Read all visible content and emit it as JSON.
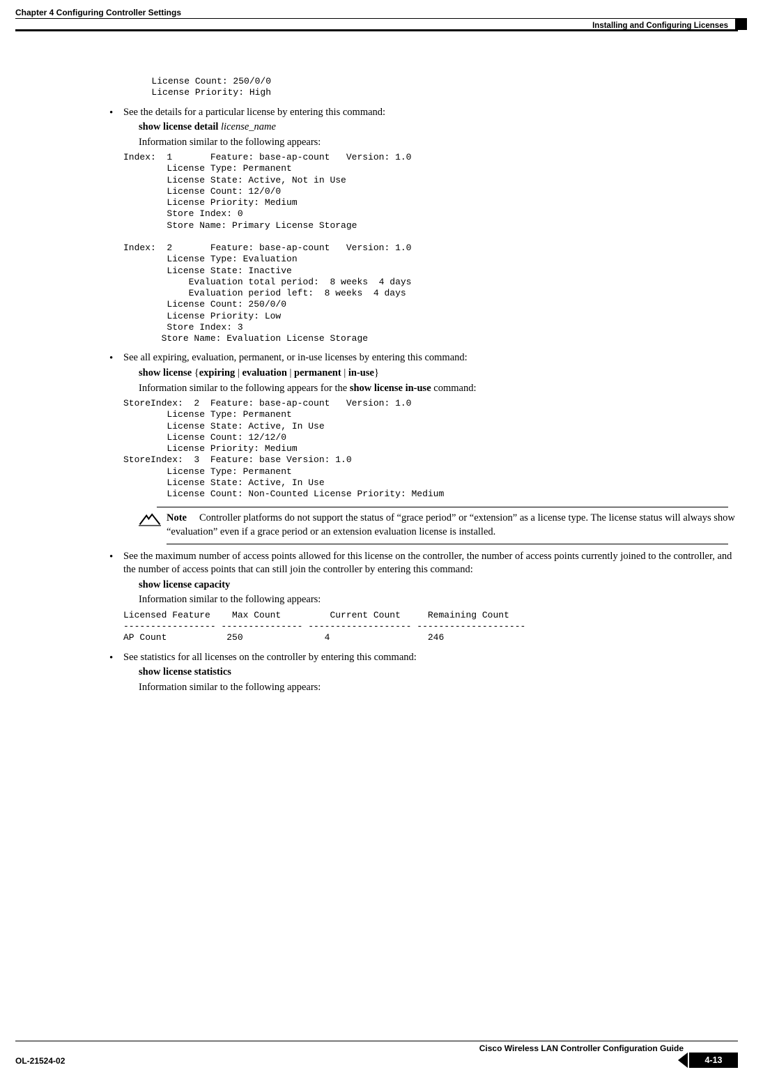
{
  "header": {
    "chapter": "Chapter 4      Configuring Controller Settings",
    "section": "Installing and Configuring Licenses"
  },
  "footer": {
    "doc_title": "Cisco Wireless LAN Controller Configuration Guide",
    "ol": "OL-21524-02",
    "page": "4-13"
  },
  "code": {
    "block0": "        License Count: 250/0/0\n        License Priority: High",
    "block1": "Index:  1       Feature: base-ap-count   Version: 1.0\n        License Type: Permanent\n        License State: Active, Not in Use\n        License Count: 12/0/0\n        License Priority: Medium\n        Store Index: 0\n        Store Name: Primary License Storage\n\nIndex:  2       Feature: base-ap-count   Version: 1.0\n        License Type: Evaluation\n        License State: Inactive\n            Evaluation total period:  8 weeks  4 days\n            Evaluation period left:  8 weeks  4 days\n        License Count: 250/0/0\n        License Priority: Low\n        Store Index: 3\n       Store Name: Evaluation License Storage",
    "block2": "StoreIndex:  2  Feature: base-ap-count   Version: 1.0\n        License Type: Permanent\n        License State: Active, In Use\n        License Count: 12/12/0\n        License Priority: Medium\nStoreIndex:  3  Feature: base Version: 1.0\n        License Type: Permanent\n        License State: Active, In Use\n        License Count: Non-Counted License Priority: Medium",
    "block3": "Licensed Feature    Max Count         Current Count     Remaining Count\n----------------- --------------- ------------------- --------------------\nAP Count           250               4                  246"
  },
  "bullet1": {
    "text": "See the details for a particular license by entering this command:",
    "cmd_b": "show license detail",
    "cmd_i": " license_name",
    "info": "Information similar to the following appears:"
  },
  "bullet2": {
    "text": "See all expiring, evaluation, permanent, or in-use licenses by entering this command:",
    "cmd_pre": "show license",
    "cmd_brace_open": " {",
    "cmd_o1": "expiring",
    "sep": " | ",
    "cmd_o2": "evaluation",
    "cmd_o3": "permanent",
    "cmd_o4": "in-use",
    "cmd_brace_close": "}",
    "info_pre": "Information similar to the following appears for the ",
    "info_bold": "show license in-use",
    "info_post": " command:"
  },
  "note": {
    "label": "Note",
    "text": "Controller platforms do not support the status of “grace period” or “extension” as a license type. The license status will always show “evaluation” even if a grace period or an extension evaluation license is installed."
  },
  "bullet3": {
    "text": "See the maximum number of access points allowed for this license on the controller, the number of access points currently joined to the controller, and the number of access points that can still join the controller by entering this command:",
    "cmd": "show license capacity",
    "info": "Information similar to the following appears:"
  },
  "bullet4": {
    "text": "See statistics for all licenses on the controller by entering this command:",
    "cmd": "show license statistics",
    "info": "Information similar to the following appears:"
  }
}
